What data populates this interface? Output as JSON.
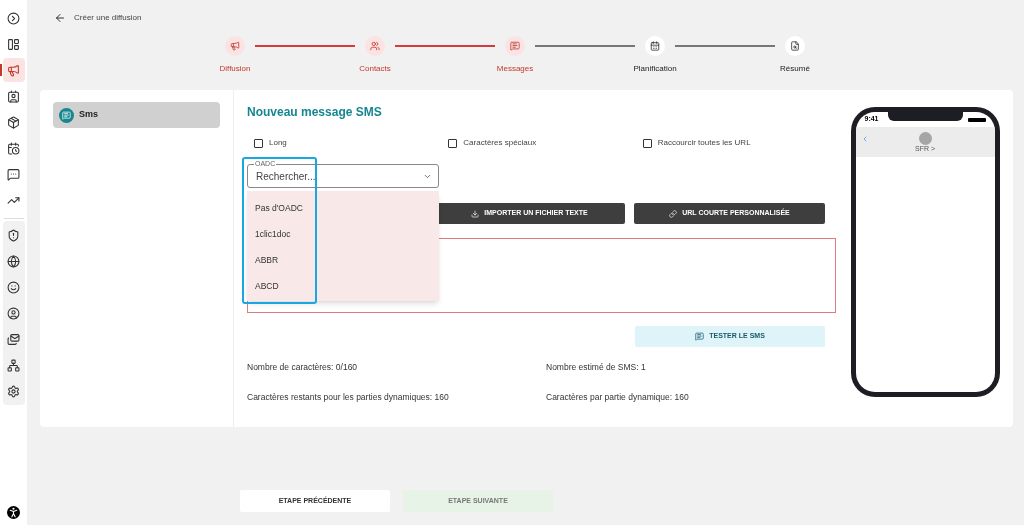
{
  "sidebar": {
    "top_items": [
      {
        "selected": false
      },
      {
        "selected": false
      },
      {
        "selected": true
      },
      {
        "selected": false
      },
      {
        "selected": false
      },
      {
        "selected": false
      },
      {
        "selected": false
      },
      {
        "selected": false
      }
    ],
    "bottom_items": [
      {
        "selected": false
      },
      {
        "selected": false
      },
      {
        "selected": false
      },
      {
        "selected": false
      },
      {
        "selected": false
      },
      {
        "selected": false
      },
      {
        "selected": false
      }
    ]
  },
  "header": {
    "title": "Créer une diffusion"
  },
  "steps": [
    {
      "label": "Diffusion",
      "reached": true
    },
    {
      "label": "Contacts",
      "reached": true
    },
    {
      "label": "Messages",
      "reached": true
    },
    {
      "label": "Planification",
      "reached": false
    },
    {
      "label": "Résumé",
      "reached": false
    }
  ],
  "channels": [
    {
      "label": "Sms",
      "selected": true
    }
  ],
  "form": {
    "title": "Nouveau message SMS",
    "options": [
      {
        "label": "Long",
        "checked": false
      },
      {
        "label": "Caractères spéciaux",
        "checked": false
      },
      {
        "label": "Raccourcir toutes les URL",
        "checked": false
      }
    ],
    "oadc": {
      "label": "OADC",
      "placeholder": "Rechercher...",
      "expanded": true,
      "options": [
        {
          "label": "Pas d'OADC",
          "selected": false
        },
        {
          "label": "1clic1doc",
          "selected": false
        },
        {
          "label": "ABBR",
          "selected": false
        },
        {
          "label": "ABCD",
          "selected": false
        }
      ]
    },
    "actions": [
      {
        "label": "IMPORTER UN FICHIER TEXTE",
        "kind": "import"
      },
      {
        "label": "URL COURTE PERSONNALISÉE",
        "kind": "link"
      }
    ],
    "test_button": "TESTER LE SMS",
    "stats": [
      "Nombre de caractères: 0/160",
      "Nombre estimé de SMS: 1",
      "Caractères restants pour les parties dynamiques: 160",
      "Caractères par partie dynamique: 160"
    ]
  },
  "phone": {
    "time": "9:41",
    "contact": "SFR >"
  },
  "footer": {
    "previous": {
      "label": "ETAPE PRÉCÉDENTE",
      "disabled": false
    },
    "next": {
      "label": "ETAPE SUIVANTE",
      "disabled": true
    }
  }
}
